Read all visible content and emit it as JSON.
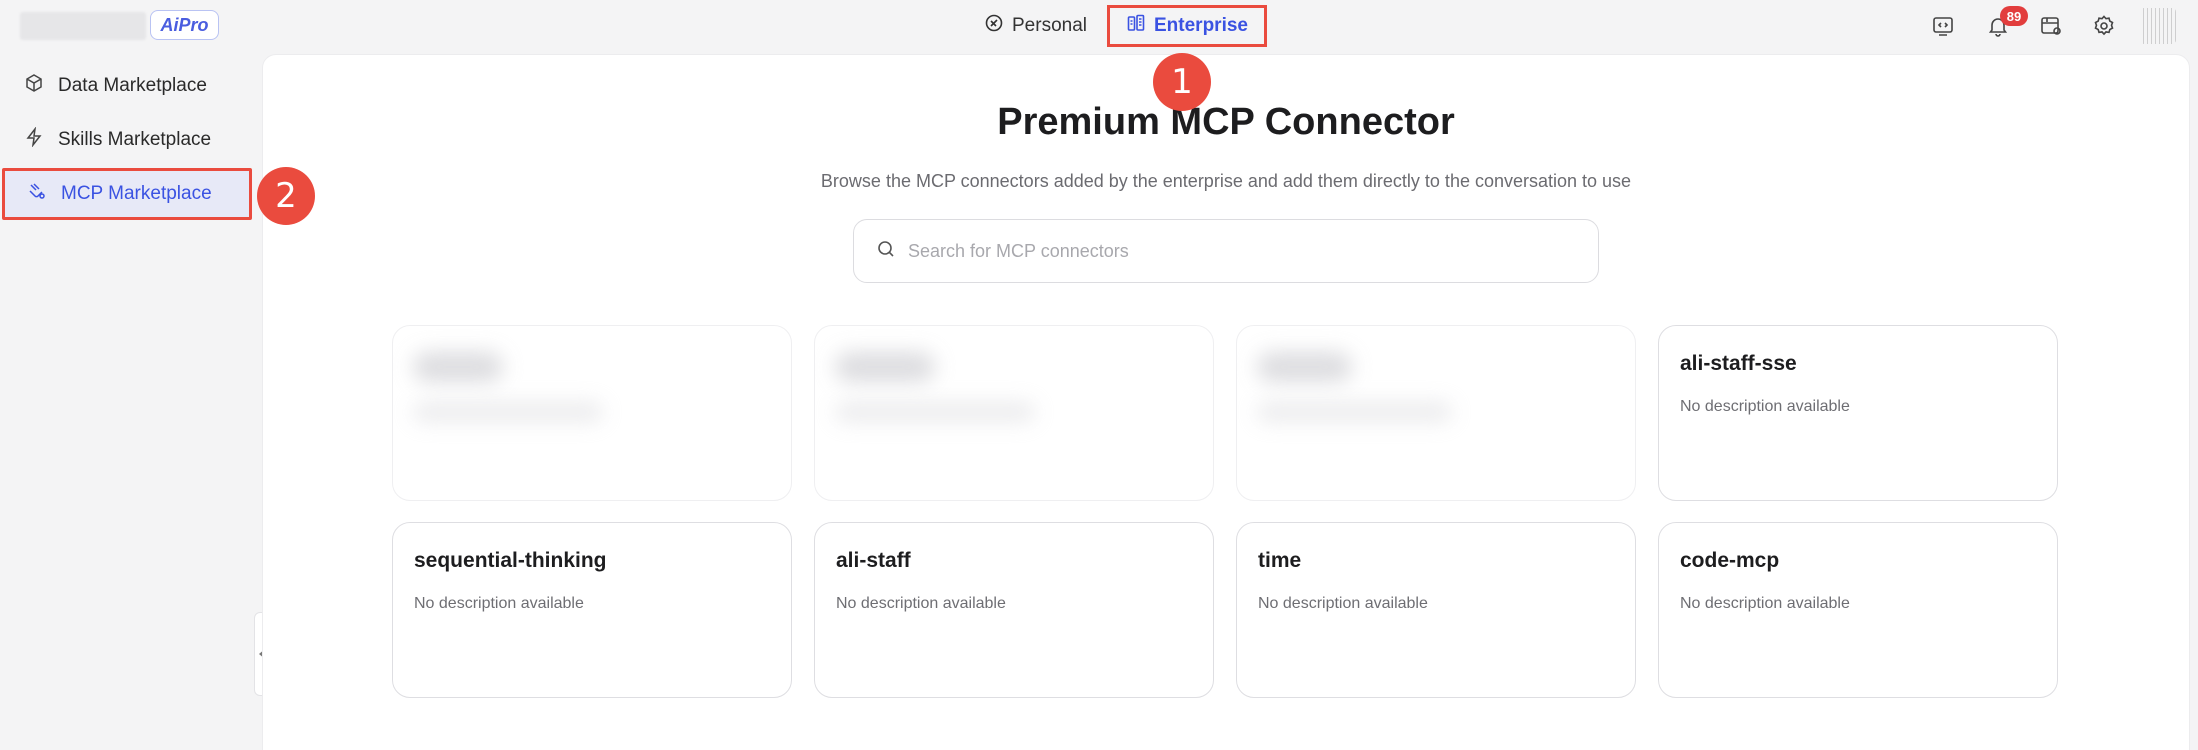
{
  "brand": {
    "product_badge": "AiPro"
  },
  "modes": {
    "personal": "Personal",
    "enterprise": "Enterprise"
  },
  "notifications": {
    "count": "89"
  },
  "sidebar": {
    "items": [
      {
        "label": "Data Marketplace",
        "icon": "cube-icon"
      },
      {
        "label": "Skills Marketplace",
        "icon": "lightning-icon"
      },
      {
        "label": "MCP Marketplace",
        "icon": "mcp-icon",
        "active": true
      }
    ]
  },
  "annotations": {
    "marker1": "1",
    "marker2": "2"
  },
  "main": {
    "title": "Premium MCP Connector",
    "subtitle": "Browse the MCP connectors added by the enterprise and add them directly to the conversation to use",
    "search_placeholder": "Search for MCP connectors",
    "cards": [
      {
        "name": "ali-staff-sse",
        "description": "No description available"
      },
      {
        "name": "sequential-thinking",
        "description": "No description available"
      },
      {
        "name": "ali-staff",
        "description": "No description available"
      },
      {
        "name": "time",
        "description": "No description available"
      },
      {
        "name": "code-mcp",
        "description": "No description available"
      }
    ]
  },
  "colors": {
    "accent": "#3a52e2",
    "annotation": "#ea4b3e",
    "badge": "#e23d3d"
  }
}
